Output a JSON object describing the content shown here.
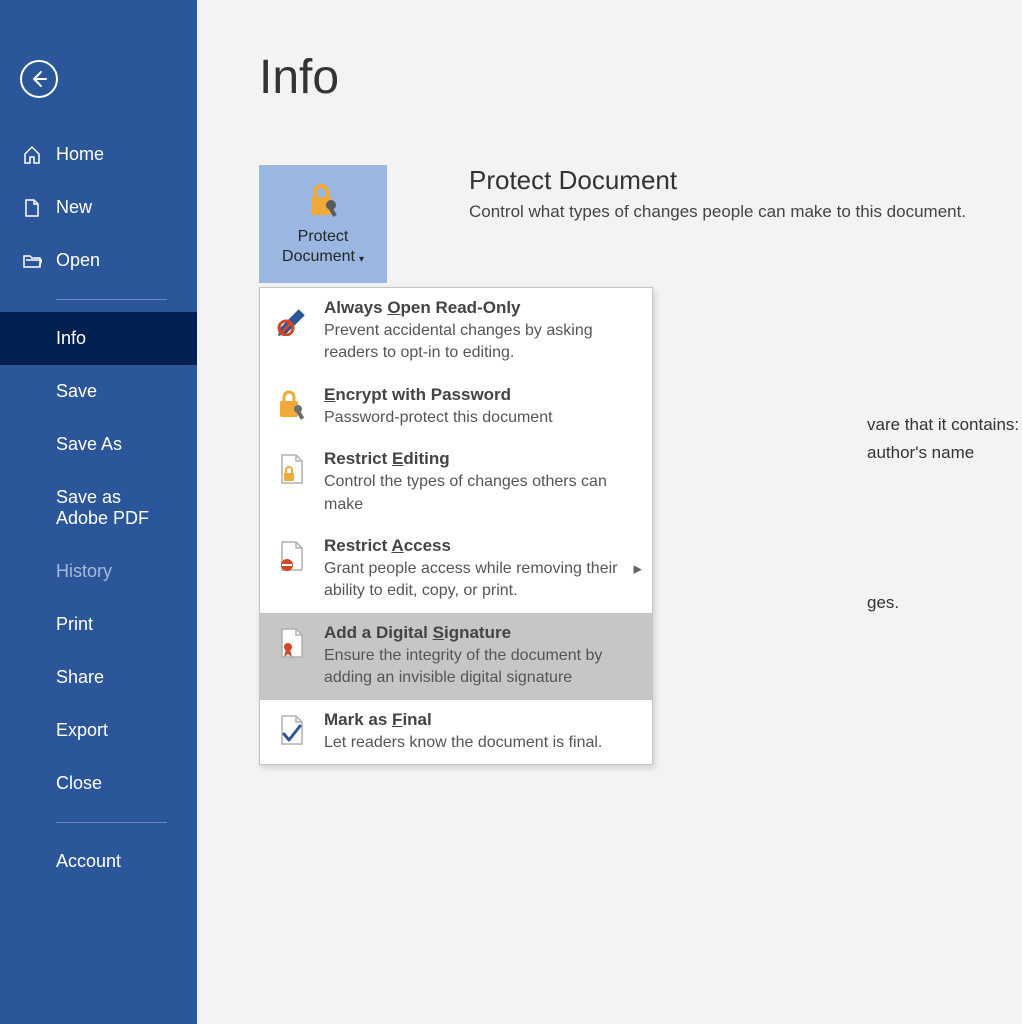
{
  "sidebar": {
    "back": "Back",
    "home": "Home",
    "new": "New",
    "open": "Open",
    "info": "Info",
    "save": "Save",
    "save_as": "Save As",
    "save_pdf": "Save as Adobe PDF",
    "history": "History",
    "print": "Print",
    "share": "Share",
    "export": "Export",
    "close": "Close",
    "account": "Account"
  },
  "page": {
    "title": "Info"
  },
  "protect": {
    "button_line1": "Protect",
    "button_line2": "Document",
    "heading": "Protect Document",
    "description": "Control what types of changes people can make to this document."
  },
  "behind": {
    "line1": "vare that it contains:",
    "line2": "author's name",
    "line3": "ges."
  },
  "dropdown": {
    "items": [
      {
        "title_pre": "Always ",
        "title_u": "O",
        "title_post": "pen Read-Only",
        "desc": "Prevent accidental changes by asking readers to opt-in to editing.",
        "icon": "pencil-no",
        "submenu": false
      },
      {
        "title_pre": "",
        "title_u": "E",
        "title_post": "ncrypt with Password",
        "desc": "Password-protect this document",
        "icon": "lock-key",
        "submenu": false
      },
      {
        "title_pre": "Restrict ",
        "title_u": "E",
        "title_post": "diting",
        "desc": "Control the types of changes others can make",
        "icon": "doc-lock",
        "submenu": false
      },
      {
        "title_pre": "Restrict ",
        "title_u": "A",
        "title_post": "ccess",
        "desc": "Grant people access while removing their ability to edit, copy, or print.",
        "icon": "doc-deny",
        "submenu": true
      },
      {
        "title_pre": "Add a Digital ",
        "title_u": "S",
        "title_post": "ignature",
        "desc": "Ensure the integrity of the document by adding an invisible digital signature",
        "icon": "doc-ribbon",
        "submenu": false
      },
      {
        "title_pre": "Mark as ",
        "title_u": "F",
        "title_post": "inal",
        "desc": "Let readers know the document is final.",
        "icon": "doc-final",
        "submenu": false
      }
    ],
    "hover_index": 4
  }
}
